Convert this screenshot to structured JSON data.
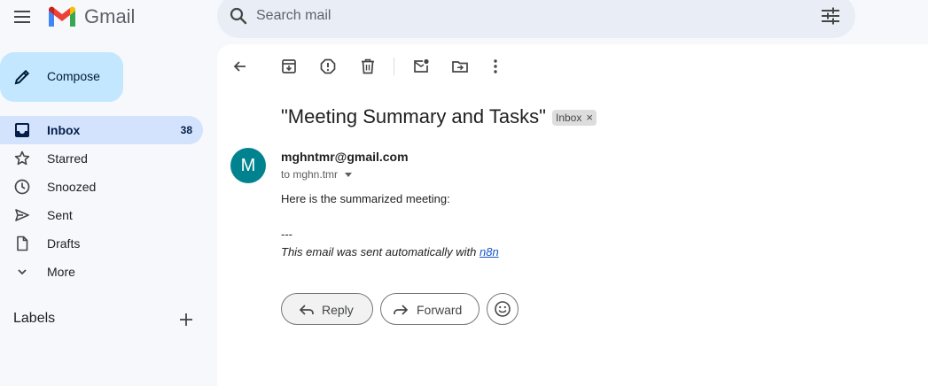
{
  "app": {
    "brand": "Gmail"
  },
  "search": {
    "placeholder": "Search mail"
  },
  "compose": {
    "label": "Compose"
  },
  "sidebar": {
    "items": [
      {
        "name": "inbox",
        "label": "Inbox",
        "count": "38",
        "icon": "inbox-icon",
        "active": true
      },
      {
        "name": "starred",
        "label": "Starred",
        "icon": "star-icon"
      },
      {
        "name": "snoozed",
        "label": "Snoozed",
        "icon": "clock-icon"
      },
      {
        "name": "sent",
        "label": "Sent",
        "icon": "send-icon"
      },
      {
        "name": "drafts",
        "label": "Drafts",
        "icon": "draft-icon"
      },
      {
        "name": "more",
        "label": "More",
        "icon": "chevron-down-icon"
      }
    ],
    "labels_title": "Labels"
  },
  "email": {
    "subject": "\"Meeting Summary and Tasks\"",
    "label_chip": "Inbox",
    "chip_close": "×",
    "avatar_letter": "M",
    "sender": "mghntmr@gmail.com",
    "recipient": "to mghn.tmr",
    "body_intro": "Here is the summarized meeting:",
    "separator": "---",
    "footer_text": "This email was sent automatically with ",
    "footer_link": "n8n"
  },
  "actions": {
    "reply_label": "Reply",
    "forward_label": "Forward"
  },
  "colors": {
    "accent": "#c2e7ff",
    "active_nav": "#d3e3fd",
    "avatar": "#00838f",
    "link": "#1155cc"
  }
}
